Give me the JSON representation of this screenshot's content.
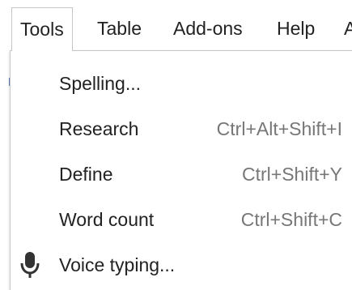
{
  "menubar": {
    "items": [
      {
        "label": "Tools",
        "active": true
      },
      {
        "label": "Table"
      },
      {
        "label": "Add-ons"
      },
      {
        "label": "Help"
      },
      {
        "label": "A"
      }
    ]
  },
  "menu": {
    "items": [
      {
        "label": "Spelling...",
        "shortcut": ""
      },
      {
        "label": "Research",
        "shortcut": "Ctrl+Alt+Shift+I"
      },
      {
        "label": "Define",
        "shortcut": "Ctrl+Shift+Y"
      },
      {
        "label": "Word count",
        "shortcut": "Ctrl+Shift+C"
      },
      {
        "label": "Voice typing...",
        "shortcut": "",
        "icon": "microphone-icon"
      }
    ]
  }
}
